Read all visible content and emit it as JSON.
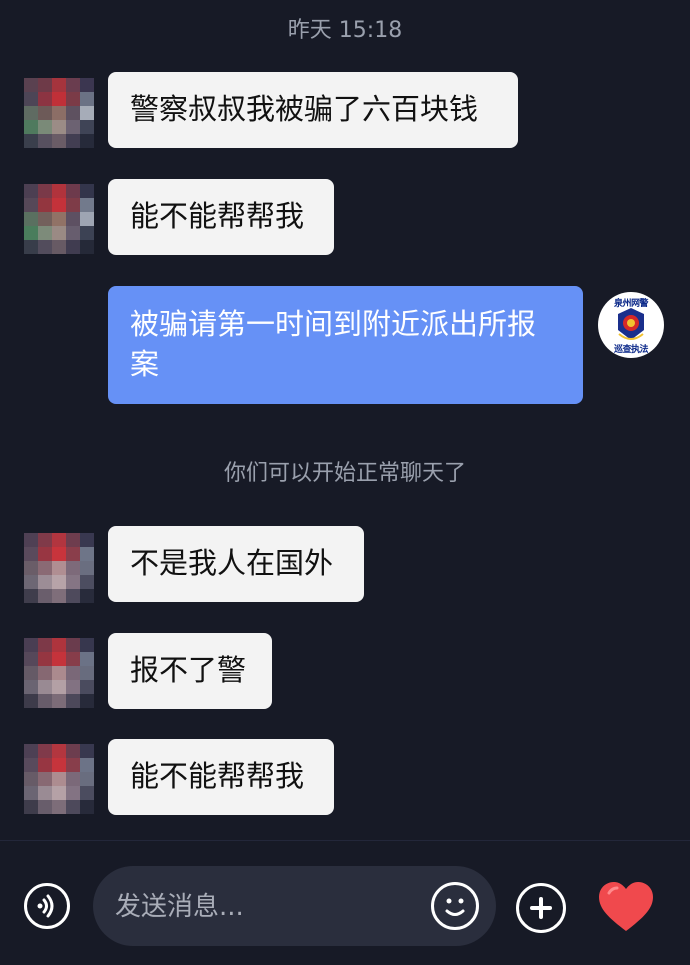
{
  "chat": {
    "timestamp": "昨天 15:18",
    "system_note": "你们可以开始正常聊天了",
    "messages": [
      {
        "direction": "in",
        "text": "警察叔叔我被骗了六百块钱"
      },
      {
        "direction": "in",
        "text": "能不能帮帮我"
      },
      {
        "direction": "out",
        "text": "被骗请第一时间到附近派出所报\n案"
      },
      {
        "direction": "in",
        "text": "不是我人在国外"
      },
      {
        "direction": "in",
        "text": "报不了警"
      },
      {
        "direction": "in",
        "text": "能不能帮帮我"
      }
    ]
  },
  "police_avatar": {
    "top_text": "泉州网警",
    "bottom_text": "巡查执法"
  },
  "input_bar": {
    "placeholder": "发送消息...",
    "icons": [
      "voice-icon",
      "emoji-icon",
      "plus-icon",
      "heart-icon"
    ]
  },
  "colors": {
    "background": "#171a26",
    "incoming_bubble": "#f3f3f3",
    "outgoing_bubble": "#6691f6",
    "heart": "#f0494d"
  }
}
